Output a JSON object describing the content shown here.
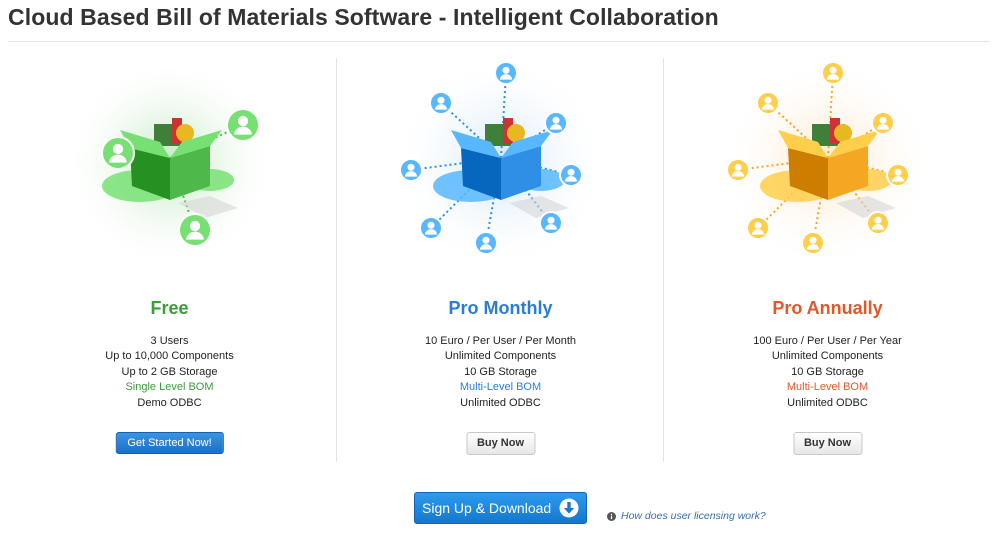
{
  "page": {
    "title": "Cloud Based Bill of Materials Software - Intelligent Collaboration"
  },
  "plans": [
    {
      "name": "Free",
      "color": "#3a9c3a",
      "features": [
        "3 Users",
        "Up to 10,000 Components",
        "Up to 2 GB Storage",
        "Single Level BOM",
        "Demo ODBC"
      ],
      "highlight_index": 3,
      "button_label": "Get Started Now!",
      "button_style": "primary",
      "box_color": "#4fb84a",
      "glow_color": "#bfe8bf"
    },
    {
      "name": "Pro Monthly",
      "color": "#2a7dd4",
      "features": [
        "10 Euro / Per User / Per Month",
        "Unlimited Components",
        "10 GB Storage",
        "Multi-Level BOM",
        "Unlimited ODBC"
      ],
      "highlight_index": 3,
      "button_label": "Buy Now",
      "button_style": "default",
      "box_color": "#2f8fe6",
      "glow_color": "#cfe6fb"
    },
    {
      "name": "Pro Annually",
      "color": "#e3572b",
      "features": [
        "100 Euro / Per User / Per Year",
        "Unlimited Components",
        "10 GB Storage",
        "Multi-Level BOM",
        "Unlimited ODBC"
      ],
      "highlight_index": 3,
      "button_label": "Buy Now",
      "button_style": "default",
      "box_color": "#f5a623",
      "glow_color": "#fde6c8"
    }
  ],
  "footer": {
    "signup_label": "Sign Up & Download",
    "signup_icon": "download-arrow-icon",
    "info_icon": "info-icon",
    "info_link": "How does user licensing work?"
  }
}
